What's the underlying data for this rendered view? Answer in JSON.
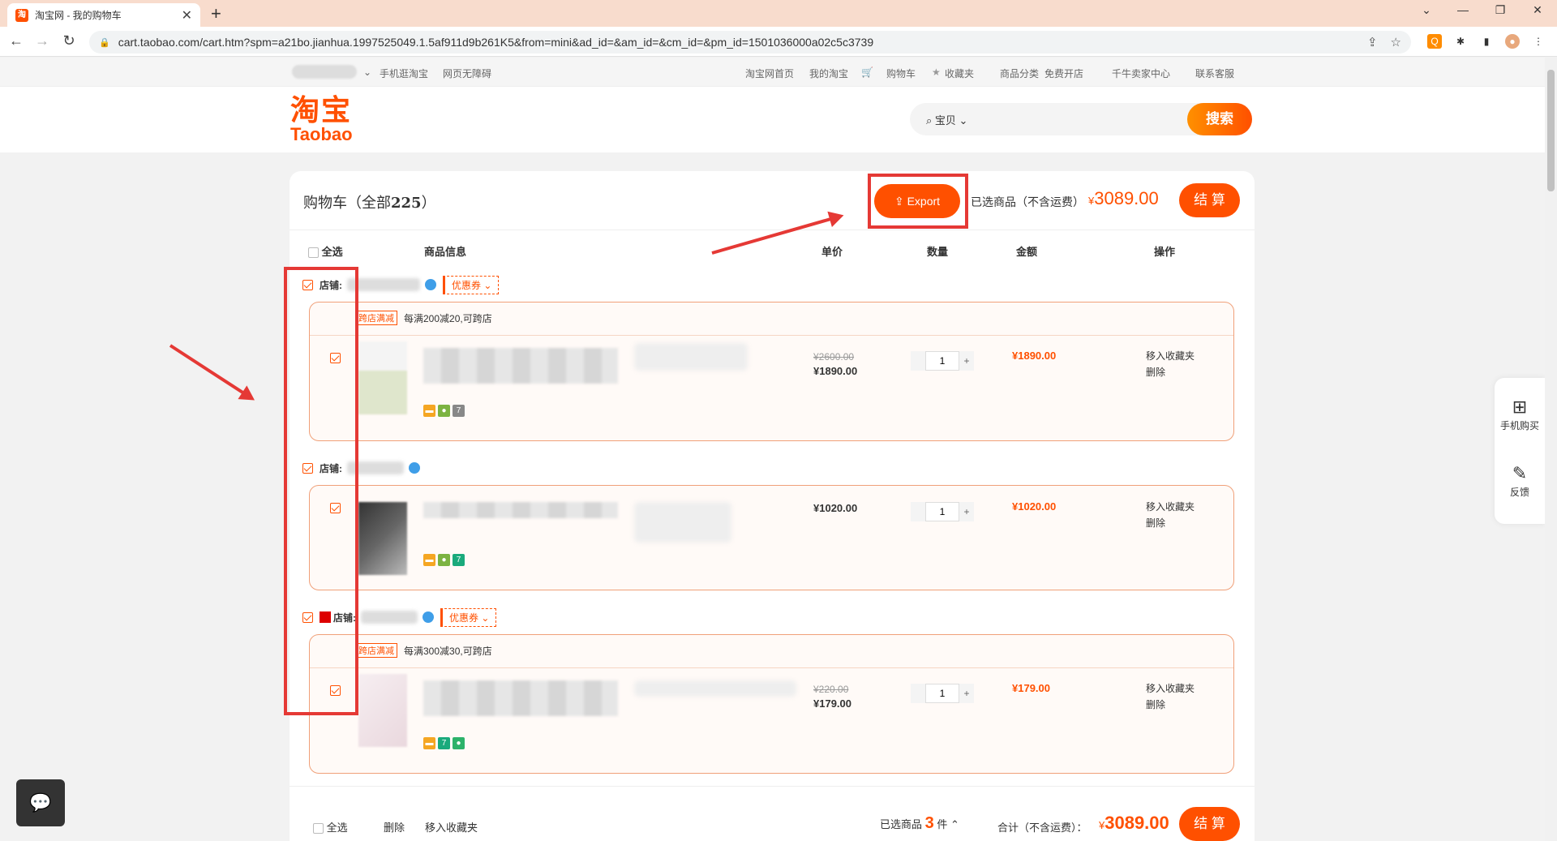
{
  "browser": {
    "tab_title": "淘宝网 - 我的购物车",
    "tab_favicon": "淘",
    "new_tab": "+",
    "url": "cart.taobao.com/cart.htm?spm=a21bo.jianhua.1997525049.1.5af911d9b261K5&from=mini&ad_id=&am_id=&cm_id=&pm_id=1501036000a02c5c3739"
  },
  "topbar": {
    "mobile": "手机逛淘宝",
    "accessible": "网页无障碍",
    "home": "淘宝网首页",
    "my_taobao": "我的淘宝",
    "cart": "购物车",
    "favorites": "收藏夹",
    "categories": "商品分类",
    "open_store": "免费开店",
    "seller_center": "千牛卖家中心",
    "support": "联系客服"
  },
  "header": {
    "logo_cn": "淘宝",
    "logo_en": "Taobao",
    "search_type": "宝贝",
    "search_button": "搜索"
  },
  "cart": {
    "title_prefix": "购物车（全部",
    "total_count": "225",
    "title_suffix": "）",
    "export_label": "Export",
    "selected_label": "已选商品（不含运费）",
    "currency": "¥",
    "selected_amount": "3089.00",
    "checkout_label": "结 算",
    "columns": {
      "select_all": "全选",
      "item_info": "商品信息",
      "unit_price": "单价",
      "quantity": "数量",
      "amount": "金额",
      "actions": "操作"
    },
    "store_label": "店铺:",
    "coupon_label": "优惠券",
    "stores": [
      {
        "promo_tag": "跨店满减",
        "promo_text": "每满200减20,可跨店",
        "item": {
          "old_price": "¥2600.00",
          "price": "¥1890.00",
          "qty": "1",
          "total": "¥1890.00"
        }
      },
      {
        "item": {
          "price": "¥1020.00",
          "qty": "1",
          "total": "¥1020.00"
        }
      },
      {
        "promo_tag": "跨店满减",
        "promo_text": "每满300减30,可跨店",
        "item": {
          "old_price": "¥220.00",
          "price": "¥179.00",
          "qty": "1",
          "total": "¥179.00"
        }
      }
    ],
    "actions": {
      "favorite": "移入收藏夹",
      "delete": "删除"
    },
    "bottom": {
      "select_all": "全选",
      "delete": "删除",
      "move_favorites": "移入收藏夹",
      "selected_prefix": "已选商品",
      "selected_count": "3",
      "selected_unit": "件",
      "total_label": "合计（不含运费）：",
      "total_amount": "3089.00",
      "checkout": "结 算"
    }
  },
  "side_tools": {
    "mobile_buy": "手机购买",
    "feedback": "反馈"
  },
  "colors": {
    "accent": "#ff5000",
    "annotation": "#e53935"
  }
}
